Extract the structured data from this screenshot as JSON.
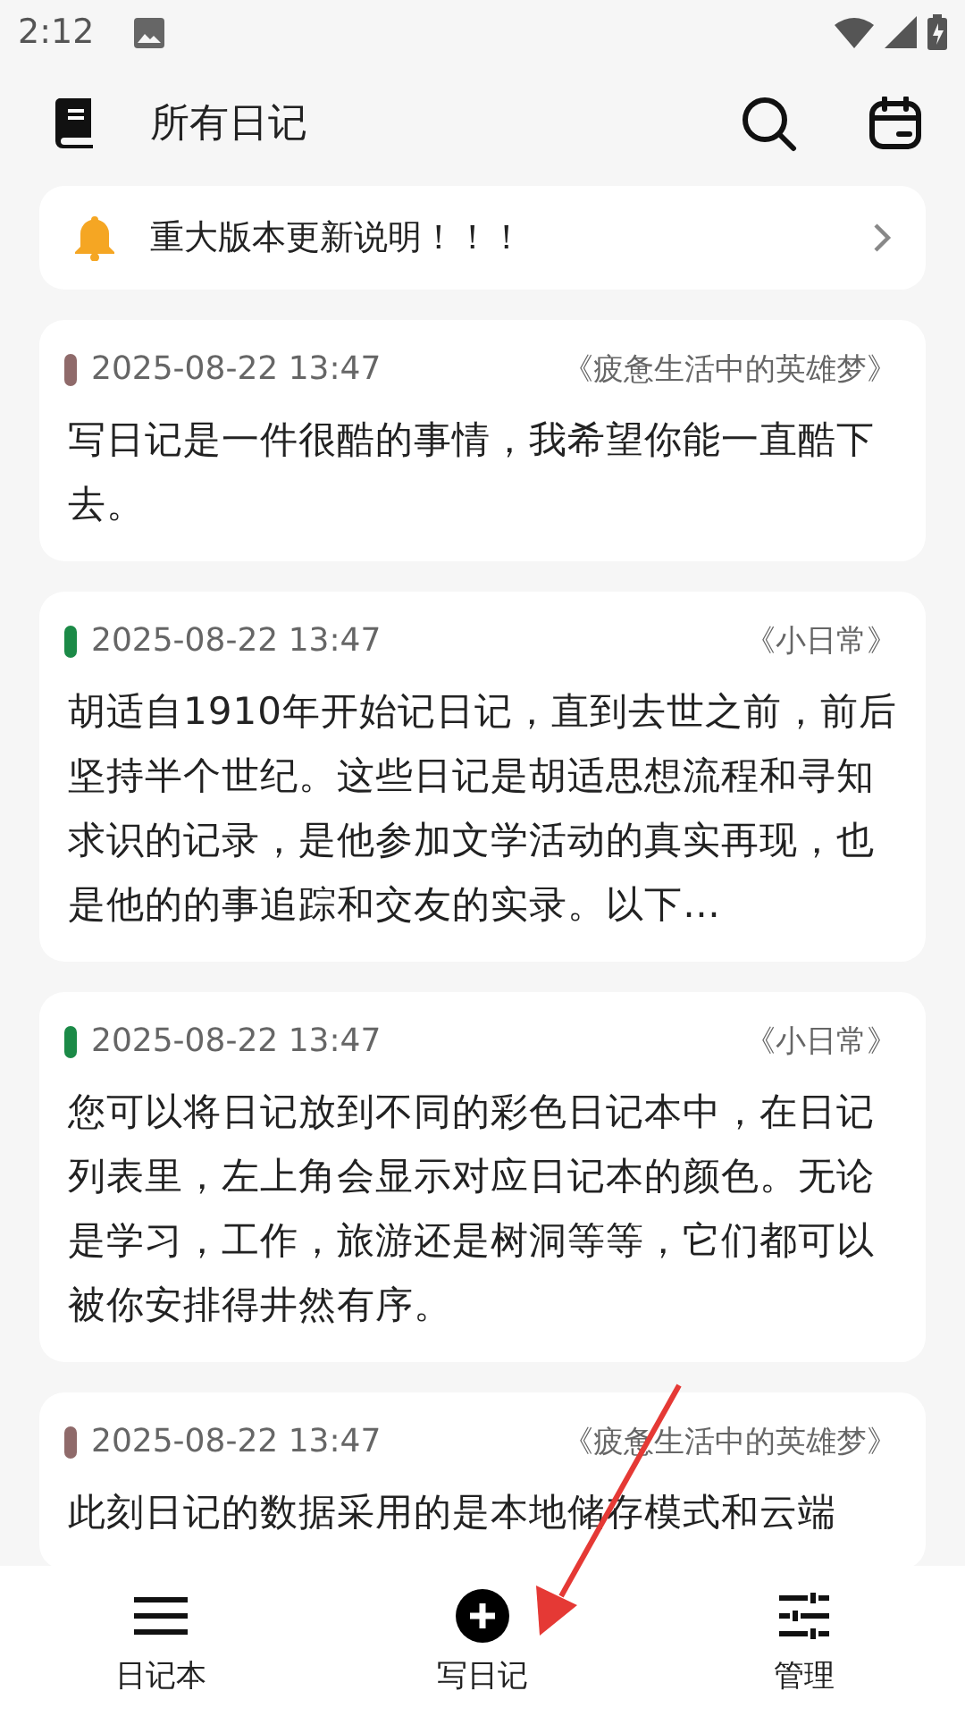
{
  "status_bar": {
    "time": "2:12"
  },
  "header": {
    "title": "所有日记"
  },
  "notice": {
    "text": "重大版本更新说明！！！"
  },
  "entries": [
    {
      "date": "2025-08-22 13:47",
      "notebook": "《疲惫生活中的英雄梦》",
      "color": "#8f6a6a",
      "text": "写日记是一件很酷的事情，我希望你能一直酷下去。"
    },
    {
      "date": "2025-08-22 13:47",
      "notebook": "《小日常》",
      "color": "#1b8a47",
      "text": "胡适自1910年开始记日记，直到去世之前，前后坚持半个世纪。这些日记是胡适思想流程和寻知求识的记录，是他参加文学活动的真实再现，也是他的的事追踪和交友的实录。以下…"
    },
    {
      "date": "2025-08-22 13:47",
      "notebook": "《小日常》",
      "color": "#1b8a47",
      "text": "您可以将日记放到不同的彩色日记本中，在日记列表里，左上角会显示对应日记本的颜色。无论是学习，工作，旅游还是树洞等等，它们都可以被你安排得井然有序。"
    },
    {
      "date": "2025-08-22 13:47",
      "notebook": "《疲惫生活中的英雄梦》",
      "color": "#8f6a6a",
      "text": "此刻日记的数据采用的是本地储存模式和云端"
    }
  ],
  "nav": [
    {
      "kind": "notebooks",
      "label": "日记本"
    },
    {
      "kind": "write",
      "label": "写日记"
    },
    {
      "kind": "manage",
      "label": "管理"
    }
  ]
}
